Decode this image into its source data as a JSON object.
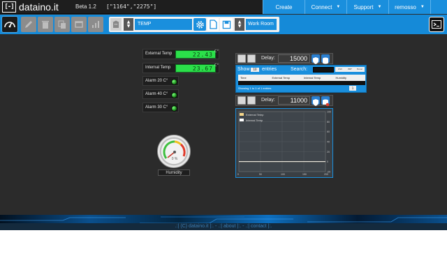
{
  "navbar": {
    "logo_mark": "[-]",
    "logo_text": "dataino.it",
    "version": "Beta 1.2",
    "coords": "[\"1164\",\"2275\"]",
    "menu": [
      {
        "label": "Create"
      },
      {
        "label": "Connect"
      },
      {
        "label": "Support"
      },
      {
        "label": "remosso"
      }
    ]
  },
  "toolbar": {
    "project_select": "TEMP",
    "workroom_label": "Work Room"
  },
  "gauges": {
    "external_temp": {
      "label": "External Temp",
      "value": "22.43",
      "unit": "C°"
    },
    "internal_temp": {
      "label": "Internal Temp",
      "value": "23.67",
      "unit": "C°"
    },
    "alarms": [
      {
        "label": "Alarm 20 C°"
      },
      {
        "label": "Alarm 40 C°"
      },
      {
        "label": "Alarm 30 C°"
      }
    ],
    "humidity": {
      "label": "Humidity",
      "value": "0 %"
    }
  },
  "table_panel": {
    "delay_label": "Delay:",
    "delay_value": "15000",
    "show_label": "Show",
    "show_value": "10",
    "entries_label": "entries",
    "search_label": "Search:",
    "buttons": [
      "CSV",
      "PDF",
      "Excel"
    ],
    "columns": [
      "Time",
      "External Temp",
      "Internal Temp",
      "Humidity"
    ],
    "info": "Showing 1 to 1 of 1 entries",
    "page": "1"
  },
  "chart_panel": {
    "delay_label": "Delay:",
    "delay_value": "11000"
  },
  "chart_data": {
    "type": "line",
    "series": [
      {
        "name": "External Temp",
        "values": [
          0,
          0
        ]
      },
      {
        "name": "Internal Temp",
        "values": [
          0,
          0
        ]
      }
    ],
    "x": [
      0,
      200
    ],
    "x_ticks": [
      "0",
      "50",
      "100",
      "150",
      "200"
    ],
    "y_ticks": [
      "100",
      "80",
      "60",
      "40",
      "20",
      "0",
      "-20"
    ],
    "xlim": [
      0,
      200
    ],
    "ylim": [
      -20,
      100
    ],
    "colors": {
      "External Temp": "#f5d68a",
      "Internal Temp": "#ffffff"
    },
    "grid": true,
    "legend": "top-left"
  },
  "footer": {
    "text": ".:| (C) dataino.it |:. - .:| about |:. - .:| contact |:."
  }
}
